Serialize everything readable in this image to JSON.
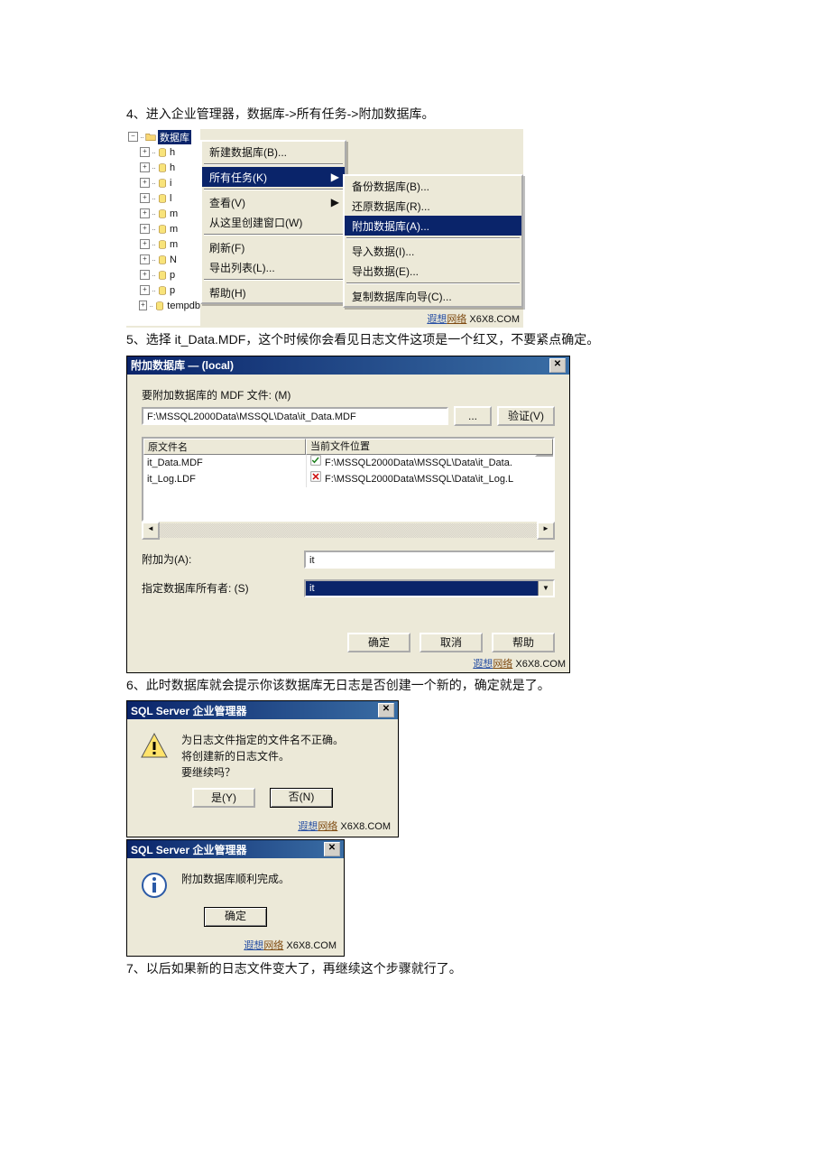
{
  "doc": {
    "step4": "4、进入企业管理器，数据库->所有任务->附加数据库。",
    "step5": "5、选择 it_Data.MDF，这个时候你会看见日志文件这项是一个红叉，不要紧点确定。",
    "step6": "6、此时数据库就会提示你该数据库无日志是否创建一个新的，确定就是了。",
    "step7": "7、以后如果新的日志文件变大了，再继续这个步骤就行了。"
  },
  "watermark": {
    "a": "遐想",
    "b": "网络",
    "c": " X6X8.COM"
  },
  "shot1": {
    "tree": {
      "root": "数据库",
      "items": [
        "h",
        "h",
        "i",
        "l",
        "m",
        "m",
        "m",
        "N",
        "p",
        "p",
        "tempdb"
      ]
    },
    "menu1": [
      {
        "label": "新建数据库(B)..."
      },
      {
        "sep": true
      },
      {
        "label": "所有任务(K)",
        "hi": true,
        "sub": true
      },
      {
        "sep": true
      },
      {
        "label": "查看(V)",
        "sub": true
      },
      {
        "label": "从这里创建窗口(W)"
      },
      {
        "sep": true
      },
      {
        "label": "刷新(F)"
      },
      {
        "label": "导出列表(L)..."
      },
      {
        "sep": true
      },
      {
        "label": "帮助(H)"
      }
    ],
    "menu2": [
      {
        "label": "备份数据库(B)..."
      },
      {
        "label": "还原数据库(R)..."
      },
      {
        "label": "附加数据库(A)...",
        "hi": true
      },
      {
        "sep": true
      },
      {
        "label": "导入数据(I)..."
      },
      {
        "label": "导出数据(E)..."
      },
      {
        "sep": true
      },
      {
        "label": "复制数据库向导(C)..."
      }
    ]
  },
  "shot2": {
    "title": "附加数据库 —  (local)",
    "lbl_mdf": "要附加数据库的 MDF 文件:  (M)",
    "mdf_path": "F:\\MSSQL2000Data\\MSSQL\\Data\\it_Data.MDF",
    "browse_btn": "...",
    "verify_btn": "验证(V)",
    "col_orig": "原文件名",
    "col_loc": "当前文件位置",
    "rows": [
      {
        "orig": "it_Data.MDF",
        "ok": true,
        "loc": "F:\\MSSQL2000Data\\MSSQL\\Data\\it_Data."
      },
      {
        "orig": "it_Log.LDF",
        "ok": false,
        "loc": "F:\\MSSQL2000Data\\MSSQL\\Data\\it_Log.L"
      }
    ],
    "attach_as_lbl": "附加为(A):",
    "attach_as_val": "it",
    "owner_lbl": "指定数据库所有者: (S)",
    "owner_val": "it",
    "btn_ok": "确定",
    "btn_cancel": "取消",
    "btn_help": "帮助"
  },
  "shot3": {
    "title": "SQL Server 企业管理器",
    "msg_l1": "为日志文件指定的文件名不正确。",
    "msg_l2": "将创建新的日志文件。",
    "msg_l3": "要继续吗？",
    "btn_yes": "是(Y)",
    "btn_no": "否(N)"
  },
  "shot4": {
    "title": "SQL Server 企业管理器",
    "msg": "附加数据库顺利完成。",
    "btn_ok": "确定"
  }
}
